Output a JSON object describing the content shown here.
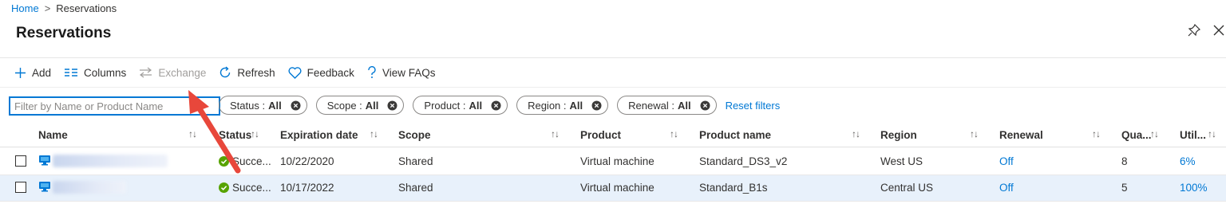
{
  "breadcrumb": {
    "home": "Home",
    "separator": ">",
    "current": "Reservations"
  },
  "page_title": "Reservations",
  "toolbar": {
    "add": "Add",
    "columns": "Columns",
    "exchange": "Exchange",
    "refresh": "Refresh",
    "feedback": "Feedback",
    "faqs": "View FAQs"
  },
  "filter": {
    "placeholder": "Filter by Name or Product Name",
    "value": ""
  },
  "pills": [
    {
      "label": "Status :",
      "value": "All"
    },
    {
      "label": "Scope :",
      "value": "All"
    },
    {
      "label": "Product :",
      "value": "All"
    },
    {
      "label": "Region :",
      "value": "All"
    },
    {
      "label": "Renewal :",
      "value": "All"
    }
  ],
  "reset_filters": "Reset filters",
  "columns": {
    "name": "Name",
    "status": "Status",
    "expiration": "Expiration date",
    "scope": "Scope",
    "product": "Product",
    "product_name": "Product name",
    "region": "Region",
    "renewal": "Renewal",
    "quantity": "Qua...",
    "utilization": "Util..."
  },
  "sort_glyph": "↑↓",
  "rows": [
    {
      "status": "Succe...",
      "expiration": "10/22/2020",
      "scope": "Shared",
      "product": "Virtual machine",
      "product_name": "Standard_DS3_v2",
      "region": "West US",
      "renewal": "Off",
      "quantity": "8",
      "utilization": "6%",
      "selected": false
    },
    {
      "status": "Succe...",
      "expiration": "10/17/2022",
      "scope": "Shared",
      "product": "Virtual machine",
      "product_name": "Standard_B1s",
      "region": "Central US",
      "renewal": "Off",
      "quantity": "5",
      "utilization": "100%",
      "selected": true
    }
  ],
  "colors": {
    "accent": "#0078d4",
    "success": "#57a300",
    "annotation_arrow": "#e8473b",
    "selected_row": "#e8f1fb"
  },
  "icons": [
    "add-icon",
    "columns-icon",
    "exchange-icon",
    "refresh-icon",
    "feedback-icon",
    "help-icon",
    "pin-icon",
    "close-icon",
    "clear-filter-icon",
    "vm-icon",
    "success-icon"
  ]
}
